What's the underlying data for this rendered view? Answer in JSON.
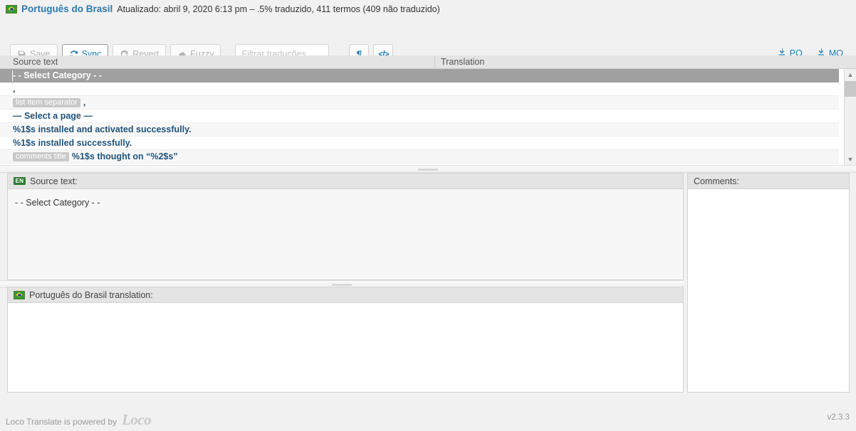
{
  "header": {
    "flag_icon": "brazil-flag-icon",
    "language": "Português do Brasil",
    "meta": "Atualizado: abril 9, 2020 6:13 pm – .5% traduzido, 411 termos (409 não traduzido)"
  },
  "toolbar": {
    "save_label": "Save",
    "save_icon": "floppy-disk-icon",
    "sync_label": "Sync",
    "sync_icon": "sync-refresh-icon",
    "revert_label": "Revert",
    "revert_icon": "revert-arrow-icon",
    "fuzzy_label": "Fuzzy",
    "fuzzy_icon": "cloud-icon",
    "filter_placeholder": "Filtrar traduções",
    "filter_value": "",
    "pilcrow_label": "¶",
    "pilcrow_icon": "pilcrow-icon",
    "code_label": "</>",
    "code_icon": "code-icon",
    "download_po_label": "PO",
    "download_mo_label": "MO",
    "download_icon": "download-icon"
  },
  "columns": {
    "source": "Source text",
    "translation": "Translation"
  },
  "rows": [
    {
      "context": "",
      "text": "- - Select Category - -",
      "selected": true
    },
    {
      "context": "",
      "text": ",",
      "selected": false
    },
    {
      "context": "list item separator",
      "text": ",",
      "selected": false
    },
    {
      "context": "",
      "text": "— Select a page —",
      "selected": false
    },
    {
      "context": "",
      "text": "%1$s installed and activated successfully.",
      "selected": false
    },
    {
      "context": "",
      "text": "%1$s installed successfully.",
      "selected": false
    },
    {
      "context": "comments title",
      "text": "%1$s thought on “%2$s”",
      "selected": false
    }
  ],
  "scrollbar": {
    "up_icon": "chevron-up-icon",
    "down_icon": "chevron-down-icon"
  },
  "editor": {
    "source_badge": "EN",
    "source_heading": "Source text:",
    "source_value": "- - Select Category - -",
    "translation_heading": "Português do Brasil translation:",
    "translation_value": "",
    "translation_flag_icon": "brazil-flag-icon",
    "comments_heading": "Comments:",
    "comments_value": ""
  },
  "footer": {
    "credit": "Loco Translate is powered by",
    "logo": "Loco",
    "version": "v2.3.3"
  }
}
